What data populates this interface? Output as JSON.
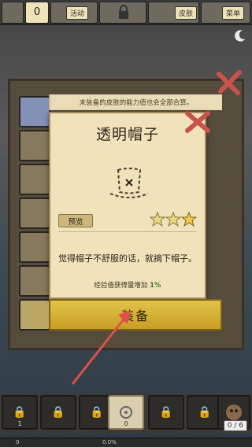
{
  "topbar": {
    "count": "0",
    "badge_left": "活动",
    "badge_mid": "皮肤",
    "badge_right": "菜单"
  },
  "notice": "未装备的皮肤的能力值也会全部合算。",
  "card": {
    "title": "透明帽子",
    "preview_label": "预览",
    "stars_filled": 3,
    "stars_total": 3,
    "description": "觉得帽子不舒服的话，就摘下帽子。",
    "xp_prefix": "经验值获得量增加",
    "xp_value": "1%"
  },
  "equip_label": "装备",
  "bottom": {
    "slot_left_number": "1",
    "center_slot_number": "0",
    "counter": "0 / 6",
    "xp_level": "0",
    "xp_percent": "0.0%"
  },
  "colors": {
    "accent_gold": "#d4b13a",
    "card_paper": "#f0e2bb",
    "arrow_red": "#e0504a",
    "xp_green": "#3e7c2c"
  },
  "icons": [
    "moon-icon",
    "close-x-icon",
    "lock-icon",
    "hat-icon",
    "star-icon",
    "gear-icon",
    "character-icon"
  ]
}
